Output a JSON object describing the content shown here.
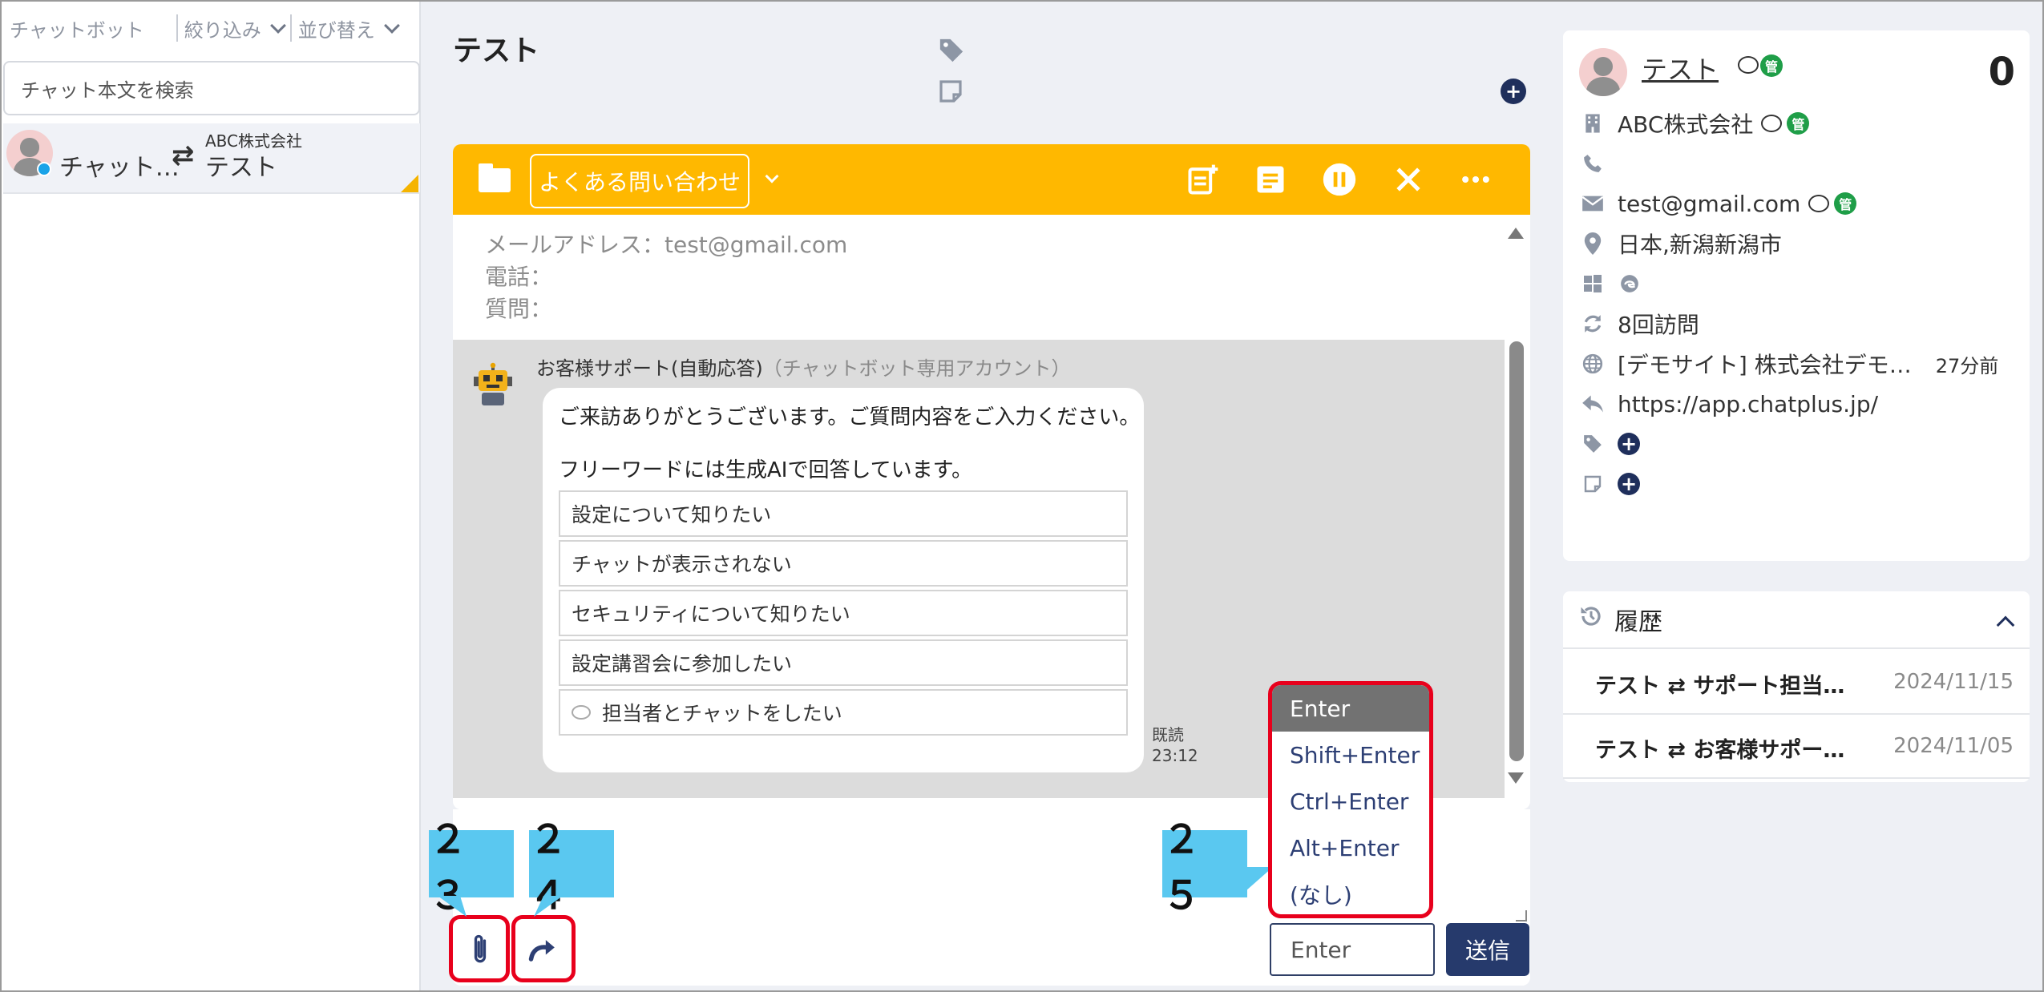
{
  "left_panel": {
    "title": "チャットボット",
    "filter_label": "絞り込み",
    "sort_label": "並び替え",
    "search_placeholder": "チャット本文を検索",
    "chat_item": {
      "visitor": "チャット…",
      "company": "ABC株式会社",
      "name": "テスト"
    }
  },
  "main": {
    "title": "テスト",
    "chat_header": {
      "faq_button": "よくある問い合わせ"
    },
    "info_lines": [
      "メールアドレス：test@gmail.com",
      "電話：",
      "質問："
    ],
    "bot_name": "お客様サポート(自動応答)",
    "bot_sub": "（チャットボット専用アカウント）",
    "bubble_line1": "ご来訪ありがとうございます。ご質問内容をご入力ください。",
    "bubble_line2": "フリーワードには生成AIで回答しています。",
    "options": [
      "設定について知りたい",
      "チャットが表示されない",
      "セキュリティについて知りたい",
      "設定講習会に参加したい",
      "担当者とチャットをしたい"
    ],
    "read_label": "既読",
    "read_time": "23:12"
  },
  "composer": {
    "send_key_value": "Enter",
    "send_button": "送信",
    "send_key_options": [
      "Enter",
      "Shift+Enter",
      "Ctrl+Enter",
      "Alt+Enter",
      "(なし)"
    ],
    "selected_option": "Enter"
  },
  "callouts": {
    "c23": "２３",
    "c24": "２４",
    "c25": "２５"
  },
  "profile": {
    "name": "テスト",
    "count": "0",
    "company": "ABC株式会社",
    "email": "test@gmail.com",
    "location": "日本,新潟新潟市",
    "visits": "8回訪問",
    "site": "[デモサイト] 株式会社デモ…",
    "site_time": "27分前",
    "referrer": "https://app.chatplus.jp/",
    "badge": "管"
  },
  "history": {
    "title": "履歴",
    "rows": [
      {
        "title": "テスト ⇄ サポート担当…",
        "date": "2024/11/15"
      },
      {
        "title": "テスト ⇄ お客様サポー…",
        "date": "2024/11/05"
      }
    ]
  },
  "colors": {
    "header_yellow": "#ffb800",
    "navy": "#263a6c",
    "callout": "#5ac8f0",
    "highlight_red": "#e8001c"
  }
}
